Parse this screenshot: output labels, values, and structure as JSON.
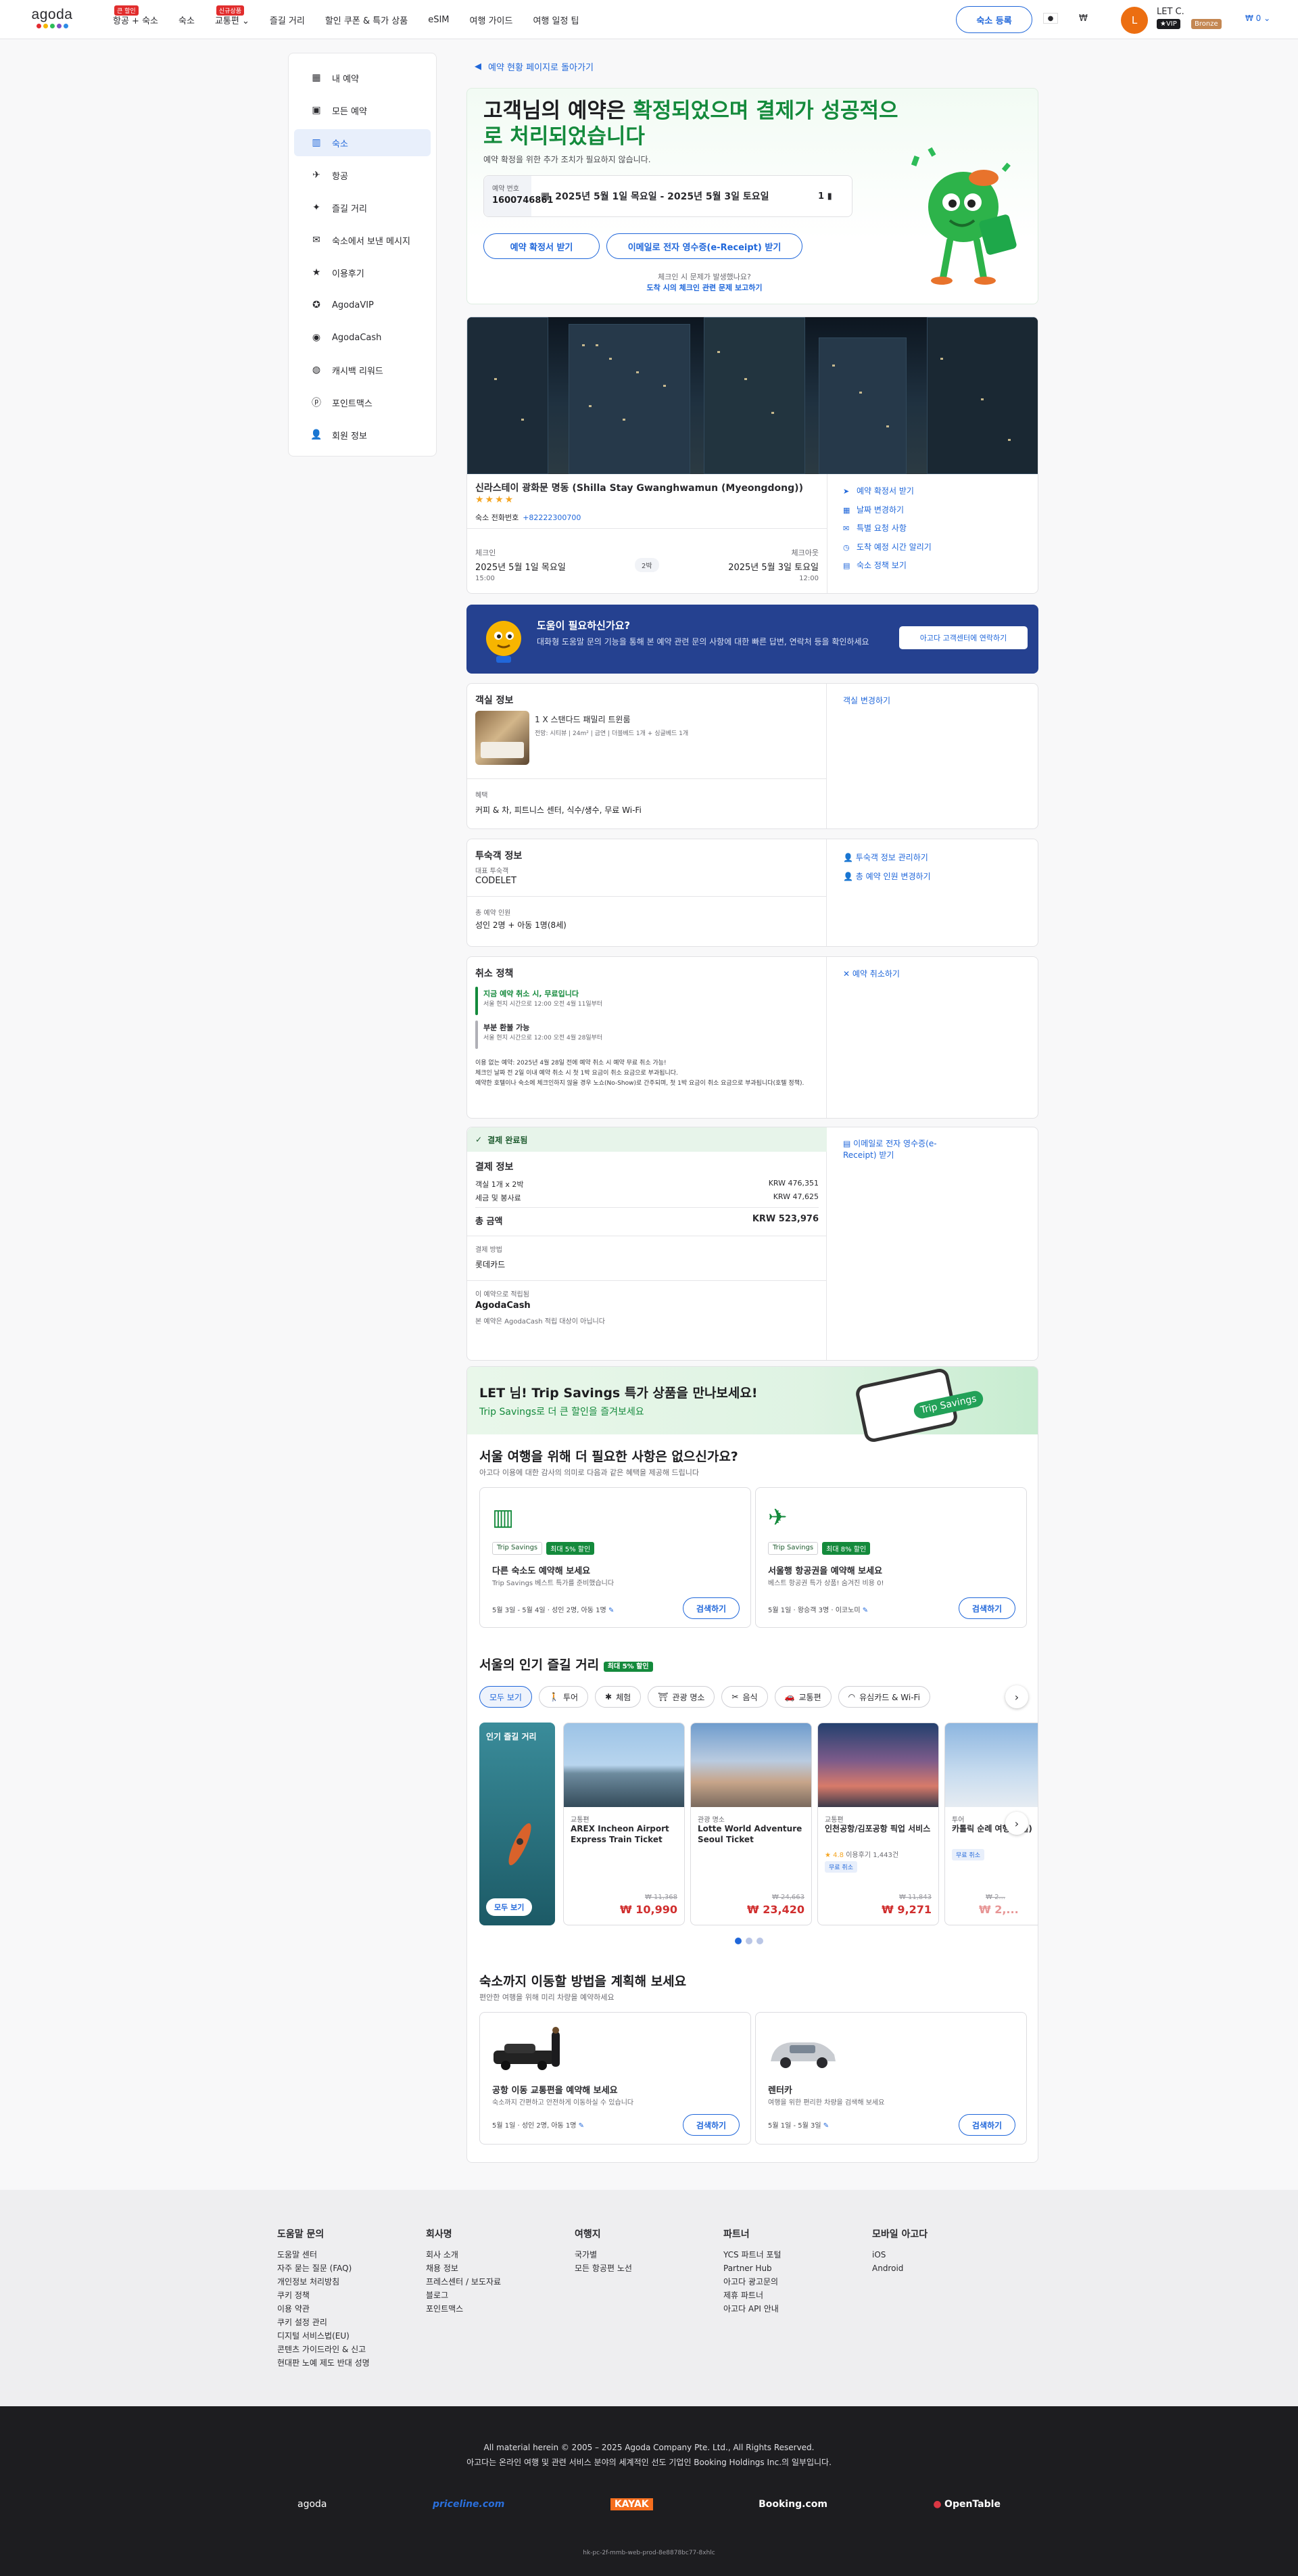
{
  "header": {
    "logo": "agoda",
    "nav": [
      {
        "label": "항공 + 숙소",
        "badge": "큰 할인"
      },
      {
        "label": "숙소",
        "badge": ""
      },
      {
        "label": "교통편",
        "badge": "신규상품"
      },
      {
        "label": "즐길 거리",
        "badge": ""
      },
      {
        "label": "할인 쿠폰 & 특가 상품",
        "badge": ""
      },
      {
        "label": "eSIM",
        "badge": ""
      },
      {
        "label": "여행 가이드",
        "badge": ""
      },
      {
        "label": "여행 일정 팁",
        "badge": ""
      }
    ],
    "list_property": "숙소 등록",
    "currency": "₩",
    "avatar_letter": "L",
    "user_name": "LET C.",
    "vip": "★VIP",
    "tier": "Bronze",
    "wallet": "₩ 0"
  },
  "sidebar": {
    "items": [
      "내 예약",
      "모든 예약",
      "숙소",
      "항공",
      "즐길 거리",
      "숙소에서 보낸 메시지",
      "이용후기",
      "AgodaVIP",
      "AgodaCash",
      "캐시백 리워드",
      "포인트맥스",
      "회원 정보"
    ],
    "icons": [
      "calendar-icon",
      "suitcase-icon",
      "building-icon",
      "plane-icon",
      "activity-icon",
      "message-icon",
      "star-icon",
      "vip-icon",
      "cash-icon",
      "cashback-icon",
      "pointsmax-icon",
      "user-icon"
    ]
  },
  "back_link": "예약 현황 페이지로 돌아가기",
  "confirm": {
    "title_a": "고객님의 예약은 ",
    "title_b": "확정되었으며 결제가 성공적으로 처리되었습니다",
    "subtitle": "예약 확정을 위한 추가 조치가 필요하지 않습니다.",
    "booking_id_label": "예약 번호",
    "booking_id": "1600746861",
    "dates": "2025년 5월 1일 목요일 - 2025년 5월 3일 토요일",
    "rooms": "1",
    "btn_confirmation": "예약 확정서 받기",
    "btn_receipt": "이메일로 전자 영수증(e-Receipt) 받기",
    "issue_q": "체크인 시 문제가 발생했나요?",
    "issue_link": "도착 시의 체크인 관련 문제 보고하기"
  },
  "hotel": {
    "name": "신라스테이 광화문 명동 (Shilla Stay Gwanghwamun (Myeongdong))",
    "stars": "★★★★",
    "phone_label": "숙소 전화번호",
    "phone": "+82222300700",
    "links": [
      "예약 확정서 받기",
      "날짜 변경하기",
      "특별 요청 사항",
      "도착 예정 시간 알리기",
      "숙소 정책 보기"
    ],
    "checkin_label": "체크인",
    "checkin_date": "2025년 5월 1일 목요일",
    "checkin_time": "15:00",
    "nights": "2박",
    "checkout_label": "체크아웃",
    "checkout_date": "2025년 5월 3일 토요일",
    "checkout_time": "12:00"
  },
  "help": {
    "title": "도움이 필요하신가요?",
    "text": "대화형 도움말 문의 기능을 통해 본 예약 관련 문의 사항에 대한 빠른 답변, 연락처 등을 확인하세요",
    "button": "아고다 고객센터에 연락하기"
  },
  "room": {
    "title": "객실 정보",
    "type": "1 X 스탠다드 패밀리 트윈룸",
    "detail": "전망: 시티뷰 | 24m² | 금연 | 더블베드 1개 + 싱글베드 1개",
    "benefit_label": "혜택",
    "benefits": "커피 & 차, 피트니스 센터, 식수/생수, 무료 Wi-Fi",
    "change_link": "객실 변경하기"
  },
  "guest": {
    "title": "투숙객 정보",
    "rep_label": "대표 투숙객",
    "rep": "CODELET",
    "total_label": "총 예약 인원",
    "total": "성인 2명 + 아동 1명(8세)",
    "link1": "투숙객 정보 관리하기",
    "link2": "총 예약 인원 변경하기"
  },
  "cancel": {
    "title": "취소 정책",
    "free_title": "지금 예약 취소 시, 무료입니다",
    "free_sub": "서울 현지 시간으로 12:00 오전 4월 11일부터",
    "partial_title": "부분 환불 가능",
    "partial_sub": "서울 현지 시간으로 12:00 오전 4월 28일부터",
    "note1": "이용 없는 예약: 2025년 4월 28일 전에 예약 취소 시 예약 무료 취소 가능!",
    "note2": "체크인 날짜 전 2일 이내 예약 취소 시 첫 1박 요금이 취소 요금으로 부과됩니다.",
    "note3": "예약한 호텔이나 숙소에 체크인하지 않을 경우 노쇼(No-Show)로 간주되며, 첫 1박 요금이 취소 요금으로 부과됩니다(호텔 정책).",
    "link": "예약 취소하기"
  },
  "payment": {
    "status": "결제 완료됨",
    "title": "결제 정보",
    "row1_label": "객실 1개 x 2박",
    "row1_val": "KRW 476,351",
    "row2_label": "세금 및 봉사료",
    "row2_val": "KRW 47,625",
    "total_label": "총 금액",
    "total_val": "KRW 523,976",
    "method_label": "결제 방법",
    "method": "롯데카드",
    "earn_label": "이 예약으로 적립됨",
    "earn": "AgodaCash",
    "earn_sub": "본 예약은 AgodaCash 적립 대상이 아닙니다",
    "receipt_link": "이메일로 전자 영수증(e-Receipt) 받기"
  },
  "promo": {
    "t1": "LET 님! Trip Savings 특가 상품을 만나보세요!",
    "t2": "Trip Savings로 더 큰 할인을 즐겨보세요",
    "badge": "Trip Savings",
    "h_need": "서울 여행을 위해 더 필요한 사항은 없으신가요?",
    "s_need": "아고다 이용에 대한 감사의 의미로 다음과 같은 혜택을 제공해 드립니다",
    "offers": [
      {
        "tag": "Trip Savings",
        "disc": "최대 5% 할인",
        "title": "다른 숙소도 예약해 보세요",
        "sub": "Trip Savings 베스트 특가를 준비했습니다",
        "date": "5월 3일 - 5월 4일 · 성인 2명, 아동 1명",
        "btn": "검색하기"
      },
      {
        "tag": "Trip Savings",
        "disc": "최대 8% 할인",
        "title": "서울행 항공권을 예약해 보세요",
        "sub": "베스트 항공권 특가 상품! 숨겨진 비용 0!",
        "date": "5월 1일 · 왕승객 3명 · 이코노미",
        "btn": "검색하기"
      }
    ],
    "h_pop": "서울의 인기 즐길 거리",
    "pop_badge": "최대 5% 할인",
    "chips": [
      "모두 보기",
      "투어",
      "체험",
      "관광 명소",
      "음식",
      "교통편",
      "유심카드 & Wi-Fi"
    ],
    "popular_title": "인기 즐길 거리",
    "popular_btn": "모두 보기",
    "acts": [
      {
        "cat": "교통편",
        "name": "AREX Incheon Airport Express Train Ticket",
        "old": "₩ 11,368",
        "price": "₩ 10,990"
      },
      {
        "cat": "관광 명소",
        "name": "Lotte World Adventure Seoul Ticket",
        "old": "₩ 24,663",
        "price": "₩ 23,420"
      },
      {
        "cat": "교통편",
        "name": "인천공항/김포공항 픽업 서비스",
        "rating": "★ 4.8",
        "reviews": "이용후기 1,443건",
        "free": "무료 취소",
        "old": "₩ 11,843",
        "price": "₩ 9,271"
      },
      {
        "cat": "투어",
        "name": "카톨릭 순례 여행 3 일)",
        "free": "무료 취소",
        "old": "₩ 2...",
        "price": "₩ 2,..."
      }
    ],
    "h_plan": "숙소까지 이동할 방법을 계획해 보세요",
    "s_plan": "편안한 여행을 위해 미리 차량을 예약하세요",
    "plans": [
      {
        "title": "공항 이동 교통편을 예약해 보세요",
        "sub": "숙소까지 간편하고 안전하게 이동하실 수 있습니다",
        "date": "5월 1일 · 성인 2명, 아동 1명",
        "btn": "검색하기"
      },
      {
        "title": "렌터카",
        "sub": "여행을 위한 편리한 차량을 검색해 보세요",
        "date": "5월 1일 - 5월 3일",
        "btn": "검색하기"
      }
    ]
  },
  "footer": {
    "cols": [
      {
        "title": "도움말 문의",
        "items": [
          "도움말 센터",
          "자주 묻는 질문 (FAQ)",
          "개인정보 처리방침",
          "쿠키 정책",
          "이용 약관",
          "쿠키 설정 관리",
          "디지털 서비스법(EU)",
          "콘텐츠 가이드라인 & 신고",
          "현대판 노예 제도 반대 성명"
        ]
      },
      {
        "title": "회사명",
        "items": [
          "회사 소개",
          "채용 정보",
          "프레스센터 / 보도자료",
          "블로그",
          "포인트맥스"
        ]
      },
      {
        "title": "여행지",
        "items": [
          "국가별",
          "모든 항공편 노선"
        ]
      },
      {
        "title": "파트너",
        "items": [
          "YCS 파트너 포털",
          "Partner Hub",
          "아고다 광고문의",
          "제휴 파트너",
          "아고다 API 안내"
        ]
      },
      {
        "title": "모바일 아고다",
        "items": [
          "iOS",
          "Android"
        ]
      }
    ],
    "copy1": "All material herein © 2005 – 2025 Agoda Company Pte. Ltd., All Rights Reserved.",
    "copy2": "아고다는 온라인 여행 및 관련 서비스 분야의 세계적인 선도 기업인 Booking Holdings Inc.의 일부입니다.",
    "brands": [
      "agoda",
      "priceline.com",
      "KAYAK",
      "Booking.com",
      "OpenTable"
    ],
    "build": "hk-pc-2f-mmb-web-prod-8e8878bc77-8xhlc"
  },
  "colors": {
    "accent": "#2067da",
    "success": "#148a3c",
    "price": "#d02e2e",
    "help_bg": "#254190"
  }
}
